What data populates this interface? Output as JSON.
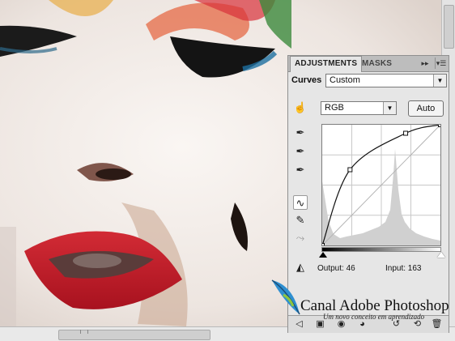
{
  "panel": {
    "tabs": [
      {
        "label": "ADJUSTMENTS",
        "active": true
      },
      {
        "label": "MASKS",
        "active": false
      }
    ],
    "menu_icons": [
      "expand-icon",
      "panel-menu-icon"
    ],
    "curves_label": "Curves",
    "preset_value": "Custom",
    "channel_value": "RGB",
    "auto_label": "Auto",
    "output_label": "Output: 46",
    "input_label": "Input: 163",
    "tools": [
      "on-image-adjust-icon",
      "black-point-eyedropper-icon",
      "gray-point-eyedropper-icon",
      "white-point-eyedropper-icon",
      "curve-point-tool-icon",
      "pencil-tool-icon",
      "smooth-curve-icon",
      "clipping-warning-icon"
    ],
    "footer_icons": [
      "back-arrow-icon",
      "expanded-view-icon",
      "clip-layer-icon",
      "visibility-eye-icon",
      "previous-state-icon",
      "reset-icon",
      "delete-icon"
    ]
  },
  "curve": {
    "points": [
      [
        0,
        0
      ],
      [
        60,
        160
      ],
      [
        180,
        237
      ],
      [
        255,
        255
      ]
    ],
    "active_point": {
      "input": 163,
      "output": 46
    }
  },
  "watermark": {
    "title": "Canal Adobe Photoshop",
    "subtitle": "Um novo conceito em aprendizado"
  },
  "colors": {
    "lip_red": "#c81a2a",
    "panel_bg": "#e6e6e6"
  }
}
